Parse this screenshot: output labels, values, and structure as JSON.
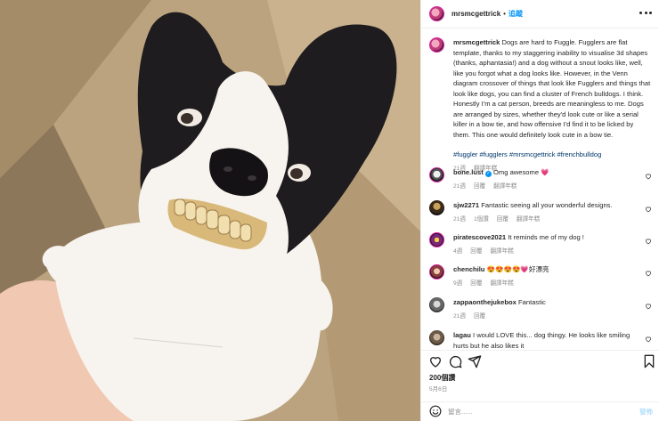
{
  "post": {
    "username": "mrsmcgettrick",
    "follow_label": "追蹤",
    "caption_text": "Dogs are hard to Fuggle. Fugglers are flat template, thanks to my staggering inability to visualise 3d shapes (thanks, aphantasia!) and a dog without a snout looks like, well, like you forgot what a dog looks like. However, in the Venn diagram crossover of things that look like Fugglers and things that look like dogs, you can find a cluster of French bulldogs. I think. Honestly I'm a cat person, breeds are meaningless to me. Dogs are arranged by sizes, whether they'd look cute or like a serial killer in a bow tie, and how offensive I'd find it to be licked by them. This one would definitely look cute in a bow tie.",
    "hashtags": "#fuggler #fugglers #mrsmcgettrick #frenchbulldog",
    "caption_age": "21週",
    "caption_translate": "翻譯年糕",
    "likes": "200個讚",
    "date": "5月6日"
  },
  "comments": [
    {
      "username": "bone.lust",
      "text": "Omg awesome 💗",
      "age": "21週",
      "reply": "回覆",
      "translate": "翻譯年糕",
      "likes": ""
    },
    {
      "username": "sjw2271",
      "text": "Fantastic seeing all your wonderful designs.",
      "age": "21週",
      "reply": "回覆",
      "translate": "翻譯年糕",
      "likes": "1個讚"
    },
    {
      "username": "piratescove2021",
      "text": "It reminds me of my dog !",
      "age": "4週",
      "reply": "回覆",
      "translate": "翻譯年糕",
      "likes": ""
    },
    {
      "username": "chenchilu",
      "text": "😍😍😍😍💗好漂亮",
      "age": "9週",
      "reply": "回覆",
      "translate": "翻譯年糕",
      "likes": ""
    },
    {
      "username": "zappaonthejukebox",
      "text": "Fantastic",
      "age": "21週",
      "reply": "回覆",
      "translate": "",
      "likes": ""
    },
    {
      "username": "lagau",
      "text": "I would LOVE this... dog thingy. He looks like smiling hurts but he also likes it",
      "age": "",
      "reply": "",
      "translate": "",
      "likes": ""
    }
  ],
  "add_comment": {
    "placeholder": "留言......",
    "post_label": "發佈"
  },
  "icons": {
    "more": "more-icon",
    "like": "heart-icon",
    "comment": "comment-icon",
    "share": "send-icon",
    "save": "bookmark-icon",
    "emoji": "emoji-icon"
  },
  "colors": {
    "link": "#0095f6",
    "hashtag": "#00376b",
    "muted": "#8e8e8e",
    "divider": "#efefef"
  }
}
